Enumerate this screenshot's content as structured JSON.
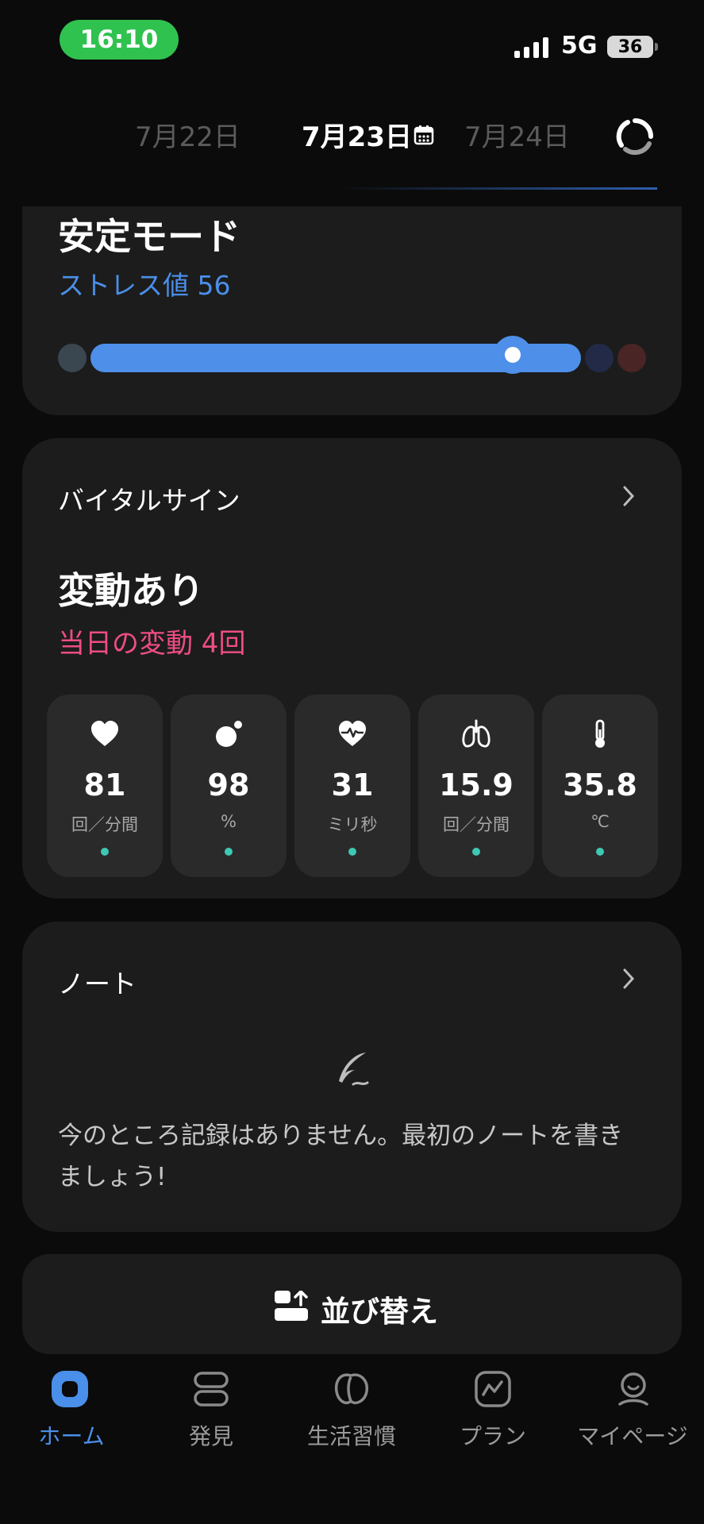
{
  "status_bar": {
    "time": "16:10",
    "network": "5G",
    "battery": "36"
  },
  "date_nav": {
    "prev": "7月22日",
    "current": "7月23日",
    "next": "7月24日"
  },
  "stress": {
    "title": "安定モード",
    "subtitle": "ストレス値 56",
    "level": 56
  },
  "vital": {
    "title": "バイタルサイン",
    "status": "変動あり",
    "changes": "当日の変動 4回",
    "tiles": [
      {
        "icon": "heart-icon",
        "value": "81",
        "unit": "回／分間"
      },
      {
        "icon": "spo2-icon",
        "value": "98",
        "unit": "%"
      },
      {
        "icon": "hrv-icon",
        "value": "31",
        "unit": "ミリ秒"
      },
      {
        "icon": "lungs-icon",
        "value": "15.9",
        "unit": "回／分間"
      },
      {
        "icon": "thermometer-icon",
        "value": "35.8",
        "unit": "℃"
      }
    ]
  },
  "note": {
    "title": "ノート",
    "empty_text": "今のところ記録はありません。最初のノートを書きましょう!"
  },
  "sort": {
    "label": "並び替え"
  },
  "tabs": [
    {
      "label": "ホーム",
      "active": true
    },
    {
      "label": "発見"
    },
    {
      "label": "生活習慣"
    },
    {
      "label": "プラン"
    },
    {
      "label": "マイページ"
    }
  ],
  "colors": {
    "accent": "#4a8fe9",
    "alert": "#ee4d83",
    "ok_dot": "#3dc9b3",
    "status_pill": "#30c24f"
  }
}
